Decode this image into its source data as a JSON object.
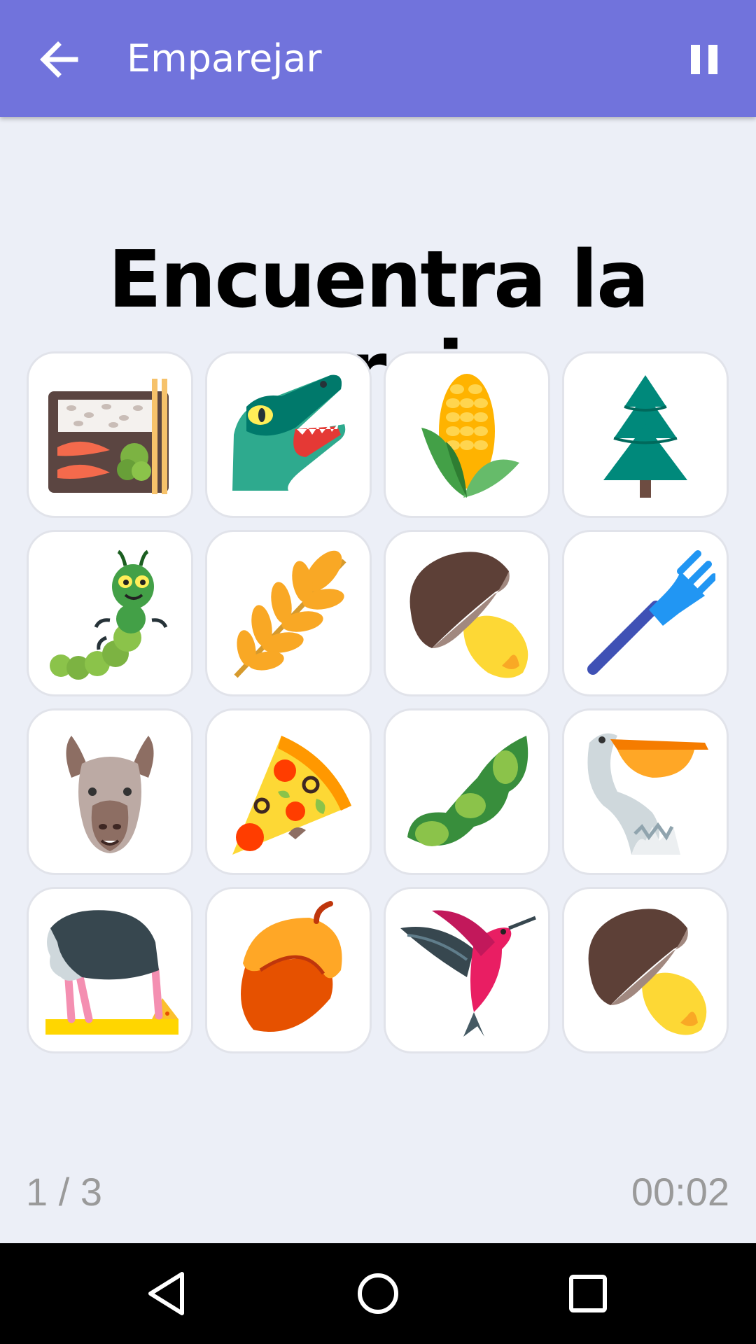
{
  "appbar": {
    "title": "Emparejar",
    "back_icon": "arrow-left-icon",
    "pause_icon": "pause-icon"
  },
  "heading": "Encuentra la pareja",
  "cards": [
    {
      "icon": "bento-box-icon"
    },
    {
      "icon": "crocodile-icon"
    },
    {
      "icon": "corn-icon"
    },
    {
      "icon": "evergreen-tree-icon"
    },
    {
      "icon": "caterpillar-icon"
    },
    {
      "icon": "wheat-icon"
    },
    {
      "icon": "mushroom-icon"
    },
    {
      "icon": "fork-icon"
    },
    {
      "icon": "llama-icon"
    },
    {
      "icon": "pizza-icon"
    },
    {
      "icon": "edamame-icon"
    },
    {
      "icon": "pelican-icon"
    },
    {
      "icon": "ostrich-icon"
    },
    {
      "icon": "acorn-icon"
    },
    {
      "icon": "hummingbird-icon"
    },
    {
      "icon": "mushroom-icon"
    }
  ],
  "footer": {
    "progress": "1 / 3",
    "timer": "00:02"
  },
  "navbar": {
    "back_icon": "nav-back-icon",
    "home_icon": "nav-home-icon",
    "recents_icon": "nav-recents-icon"
  },
  "colors": {
    "appbar": "#7173dc",
    "background": "#eceff7",
    "card": "#ffffff"
  }
}
